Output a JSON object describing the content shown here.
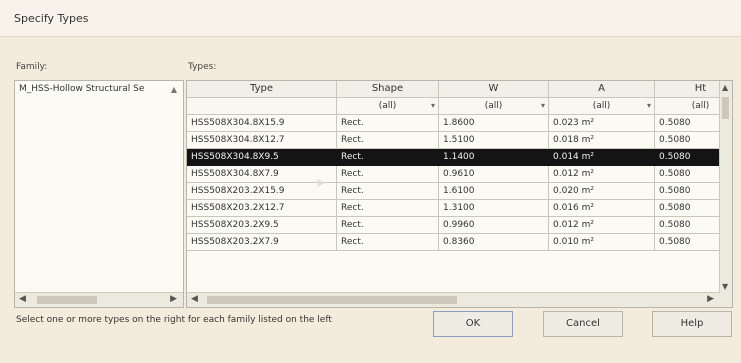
{
  "window": {
    "title": "Specify Types"
  },
  "family": {
    "label": "Family:",
    "items": [
      "M_HSS-Hollow Structural Se"
    ]
  },
  "types": {
    "label": "Types:",
    "columns": [
      "Type",
      "Shape",
      "W",
      "A",
      "Ht"
    ],
    "filter": "(all)",
    "rows": [
      {
        "type": "HSS508X304.8X15.9",
        "shape": "Rect.",
        "w": "1.8600",
        "a": "0.023 m²",
        "ht": "0.5080"
      },
      {
        "type": "HSS508X304.8X12.7",
        "shape": "Rect.",
        "w": "1.5100",
        "a": "0.018 m²",
        "ht": "0.5080"
      },
      {
        "type": "HSS508X304.8X9.5",
        "shape": "Rect.",
        "w": "1.1400",
        "a": "0.014 m²",
        "ht": "0.5080",
        "selected": true
      },
      {
        "type": "HSS508X304.8X7.9",
        "shape": "Rect.",
        "w": "0.9610",
        "a": "0.012 m²",
        "ht": "0.5080"
      },
      {
        "type": "HSS508X203.2X15.9",
        "shape": "Rect.",
        "w": "1.6100",
        "a": "0.020 m²",
        "ht": "0.5080"
      },
      {
        "type": "HSS508X203.2X12.7",
        "shape": "Rect.",
        "w": "1.3100",
        "a": "0.016 m²",
        "ht": "0.5080"
      },
      {
        "type": "HSS508X203.2X9.5",
        "shape": "Rect.",
        "w": "0.9960",
        "a": "0.012 m²",
        "ht": "0.5080"
      },
      {
        "type": "HSS508X203.2X7.9",
        "shape": "Rect.",
        "w": "0.8360",
        "a": "0.010 m²",
        "ht": "0.5080"
      }
    ]
  },
  "status_text": "Select one or more types on the right for each family listed on the left",
  "buttons": {
    "ok": "OK",
    "cancel": "Cancel",
    "help": "Help"
  },
  "icons": {
    "scroll_left": "◀",
    "scroll_right": "▶",
    "scroll_up": "▲",
    "scroll_down": "▼",
    "dropdown": "▾"
  }
}
